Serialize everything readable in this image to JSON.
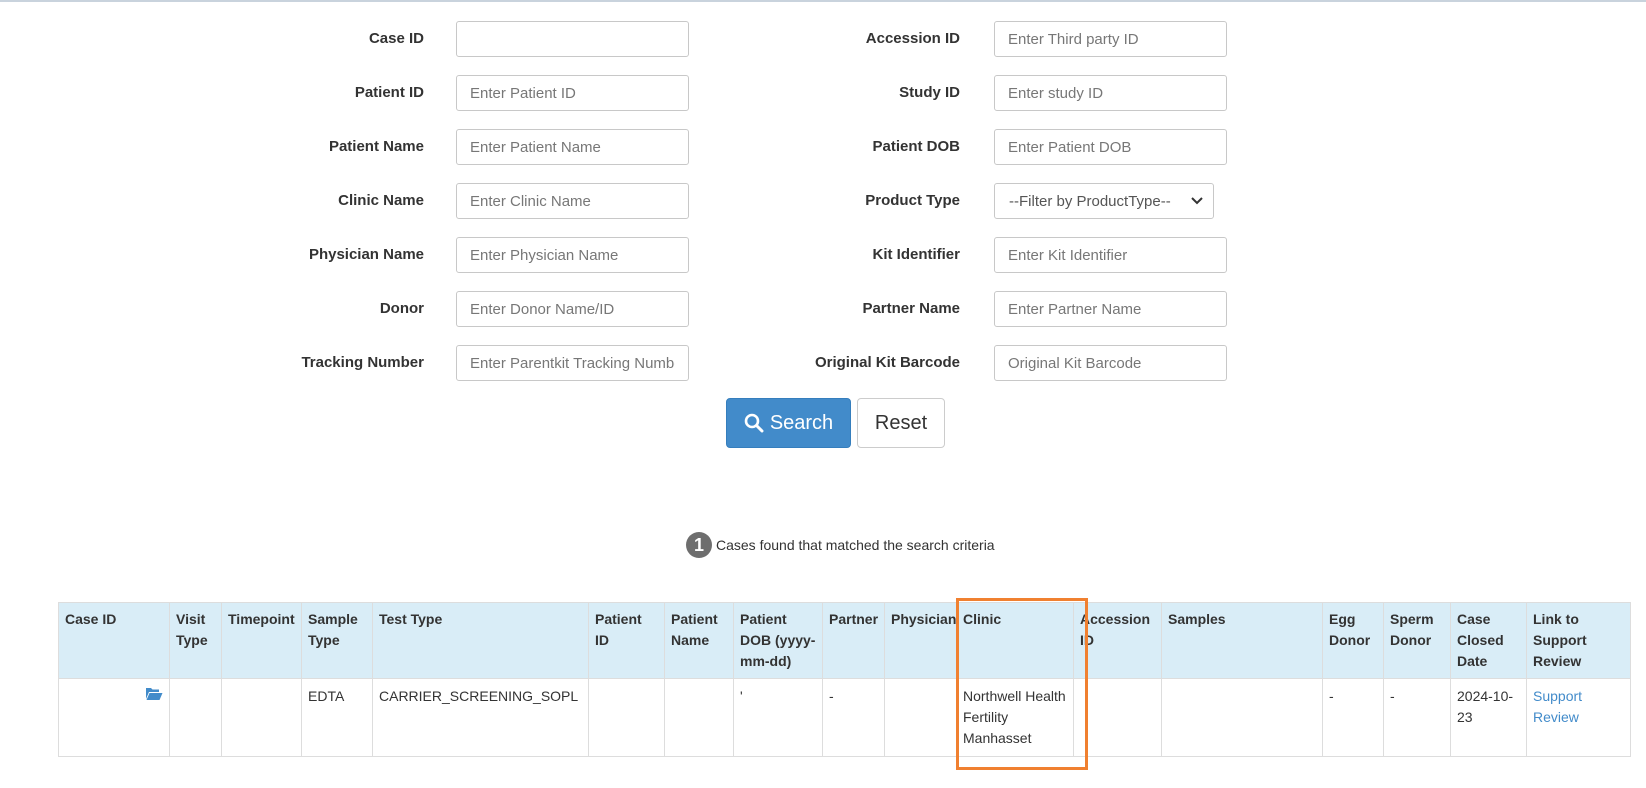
{
  "form": {
    "left": [
      {
        "key": "case_id",
        "label": "Case ID",
        "placeholder": "",
        "value": ""
      },
      {
        "key": "patient_id",
        "label": "Patient ID",
        "placeholder": "Enter Patient ID",
        "value": ""
      },
      {
        "key": "patient_name",
        "label": "Patient Name",
        "placeholder": "Enter Patient Name",
        "value": ""
      },
      {
        "key": "clinic_name",
        "label": "Clinic Name",
        "placeholder": "Enter Clinic Name",
        "value": ""
      },
      {
        "key": "physician_name",
        "label": "Physician Name",
        "placeholder": "Enter Physician Name",
        "value": ""
      },
      {
        "key": "donor",
        "label": "Donor",
        "placeholder": "Enter Donor Name/ID",
        "value": ""
      },
      {
        "key": "tracking_number",
        "label": "Tracking Number",
        "placeholder": "Enter Parentkit Tracking Number",
        "value": ""
      }
    ],
    "right": [
      {
        "key": "accession_id",
        "label": "Accession ID",
        "placeholder": "Enter Third party ID",
        "value": ""
      },
      {
        "key": "study_id",
        "label": "Study ID",
        "placeholder": "Enter study ID",
        "value": ""
      },
      {
        "key": "patient_dob",
        "label": "Patient DOB",
        "placeholder": "Enter Patient DOB",
        "value": ""
      },
      {
        "key": "product_type",
        "label": "Product Type",
        "selected": "--Filter by ProductType--"
      },
      {
        "key": "kit_identifier",
        "label": "Kit Identifier",
        "placeholder": "Enter Kit Identifier",
        "value": ""
      },
      {
        "key": "partner_name",
        "label": "Partner Name",
        "placeholder": "Enter Partner Name",
        "value": ""
      },
      {
        "key": "original_kit_barcode",
        "label": "Original Kit Barcode",
        "placeholder": "Original Kit Barcode",
        "value": ""
      }
    ],
    "search_label": "Search",
    "reset_label": "Reset"
  },
  "results": {
    "count": "1",
    "count_text": "Cases found that matched the search criteria",
    "columns": [
      "Case ID",
      "Visit Type",
      "Timepoint",
      "Sample Type",
      "Test Type",
      "Patient ID",
      "Patient Name",
      "Patient DOB (yyyy-mm-dd)",
      "Partner",
      "Physician",
      "Clinic",
      "Accession ID",
      "Samples",
      "Egg Donor",
      "Sperm Donor",
      "Case Closed Date",
      "Link to Support Review"
    ],
    "rows": [
      {
        "case_id": "",
        "visit_type": "",
        "timepoint": "",
        "sample_type": "EDTA",
        "test_type": "CARRIER_SCREENING_SOPL",
        "patient_id": "",
        "patient_name": "",
        "patient_dob": "'",
        "partner": "-",
        "physician": "",
        "clinic": "Northwell Health Fertility Manhasset",
        "accession_id": "",
        "samples": "",
        "egg_donor": "-",
        "sperm_donor": "-",
        "case_closed_date": "2024-10-23",
        "support_link": "Support Review"
      }
    ]
  },
  "colors": {
    "primary": "#428bca",
    "header_bg": "#d9edf7",
    "highlight": "#f08030",
    "badge": "#6e6e6e"
  },
  "icons": {
    "search_button": "search-icon",
    "case_row": "folder-open-icon",
    "product_select": "chevron-down-icon"
  }
}
